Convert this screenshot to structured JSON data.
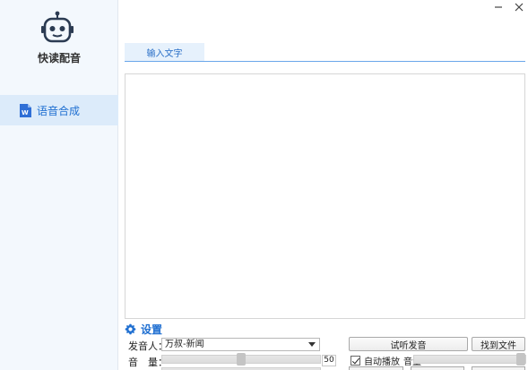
{
  "app": {
    "title": "快读配音"
  },
  "sidebar": {
    "items": [
      {
        "label": "语音合成",
        "icon": "word-doc-icon"
      }
    ]
  },
  "window": {
    "min_icon": "minimize-icon",
    "close_icon": "close-icon"
  },
  "tabs": [
    {
      "label": "输入文字",
      "active": true
    }
  ],
  "editor": {
    "value": "",
    "placeholder": ""
  },
  "settings": {
    "title": "设置",
    "voice_label": "发音人：",
    "voice_value": "万叔-新闻",
    "volume_label": "音　量：",
    "volume_value": "50",
    "volume_fraction": 0.5
  },
  "actions": {
    "preview_label": "试听发音",
    "find_file_label": "找到文件",
    "auto_play_label": "自动播放",
    "auto_play_checked": true,
    "play_volume_label": "音量",
    "play_volume_fraction": 1.0
  },
  "colors": {
    "accent": "#1f6fd1",
    "sidebar_bg": "#f3f8fd",
    "nav_active_bg": "#dcebfa"
  }
}
